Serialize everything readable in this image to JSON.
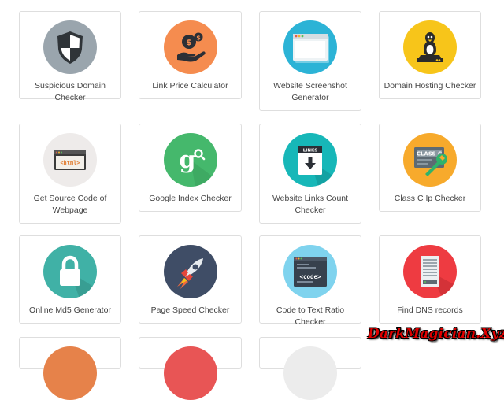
{
  "tools": [
    {
      "label": "Suspicious Domain Checker",
      "icon": "shield-icon",
      "color": "#9aa5ad"
    },
    {
      "label": "Link Price Calculator",
      "icon": "money-hand-icon",
      "color": "#f58c4f"
    },
    {
      "label": "Website Screenshot Generator",
      "icon": "browser-window-icon",
      "color": "#2cb3d6"
    },
    {
      "label": "Domain Hosting Checker",
      "icon": "linux-server-icon",
      "color": "#f7c51a"
    },
    {
      "label": "Get Source Code of Webpage",
      "icon": "html-code-icon",
      "color": "#eeebea"
    },
    {
      "label": "Google Index Checker",
      "icon": "google-search-icon",
      "color": "#45b86c"
    },
    {
      "label": "Website Links Count Checker",
      "icon": "links-document-icon",
      "color": "#17b7b8"
    },
    {
      "label": "Class C Ip Checker",
      "icon": "class-c-wrench-icon",
      "color": "#f7aa2c"
    },
    {
      "label": "Online Md5 Generator",
      "icon": "lock-icon",
      "color": "#40b1a6"
    },
    {
      "label": "Page Speed Checker",
      "icon": "rocket-icon",
      "color": "#3f4d66"
    },
    {
      "label": "Code to Text Ratio Checker",
      "icon": "code-window-icon",
      "color": "#7fd3ee"
    },
    {
      "label": "Find DNS records",
      "icon": "dns-server-icon",
      "color": "#ee3b41"
    }
  ],
  "watermark": "DarkMagician.Xyz",
  "partial_row_colors": [
    "#e6824a",
    "#e85555",
    "#cccccc",
    "#dddddd"
  ]
}
